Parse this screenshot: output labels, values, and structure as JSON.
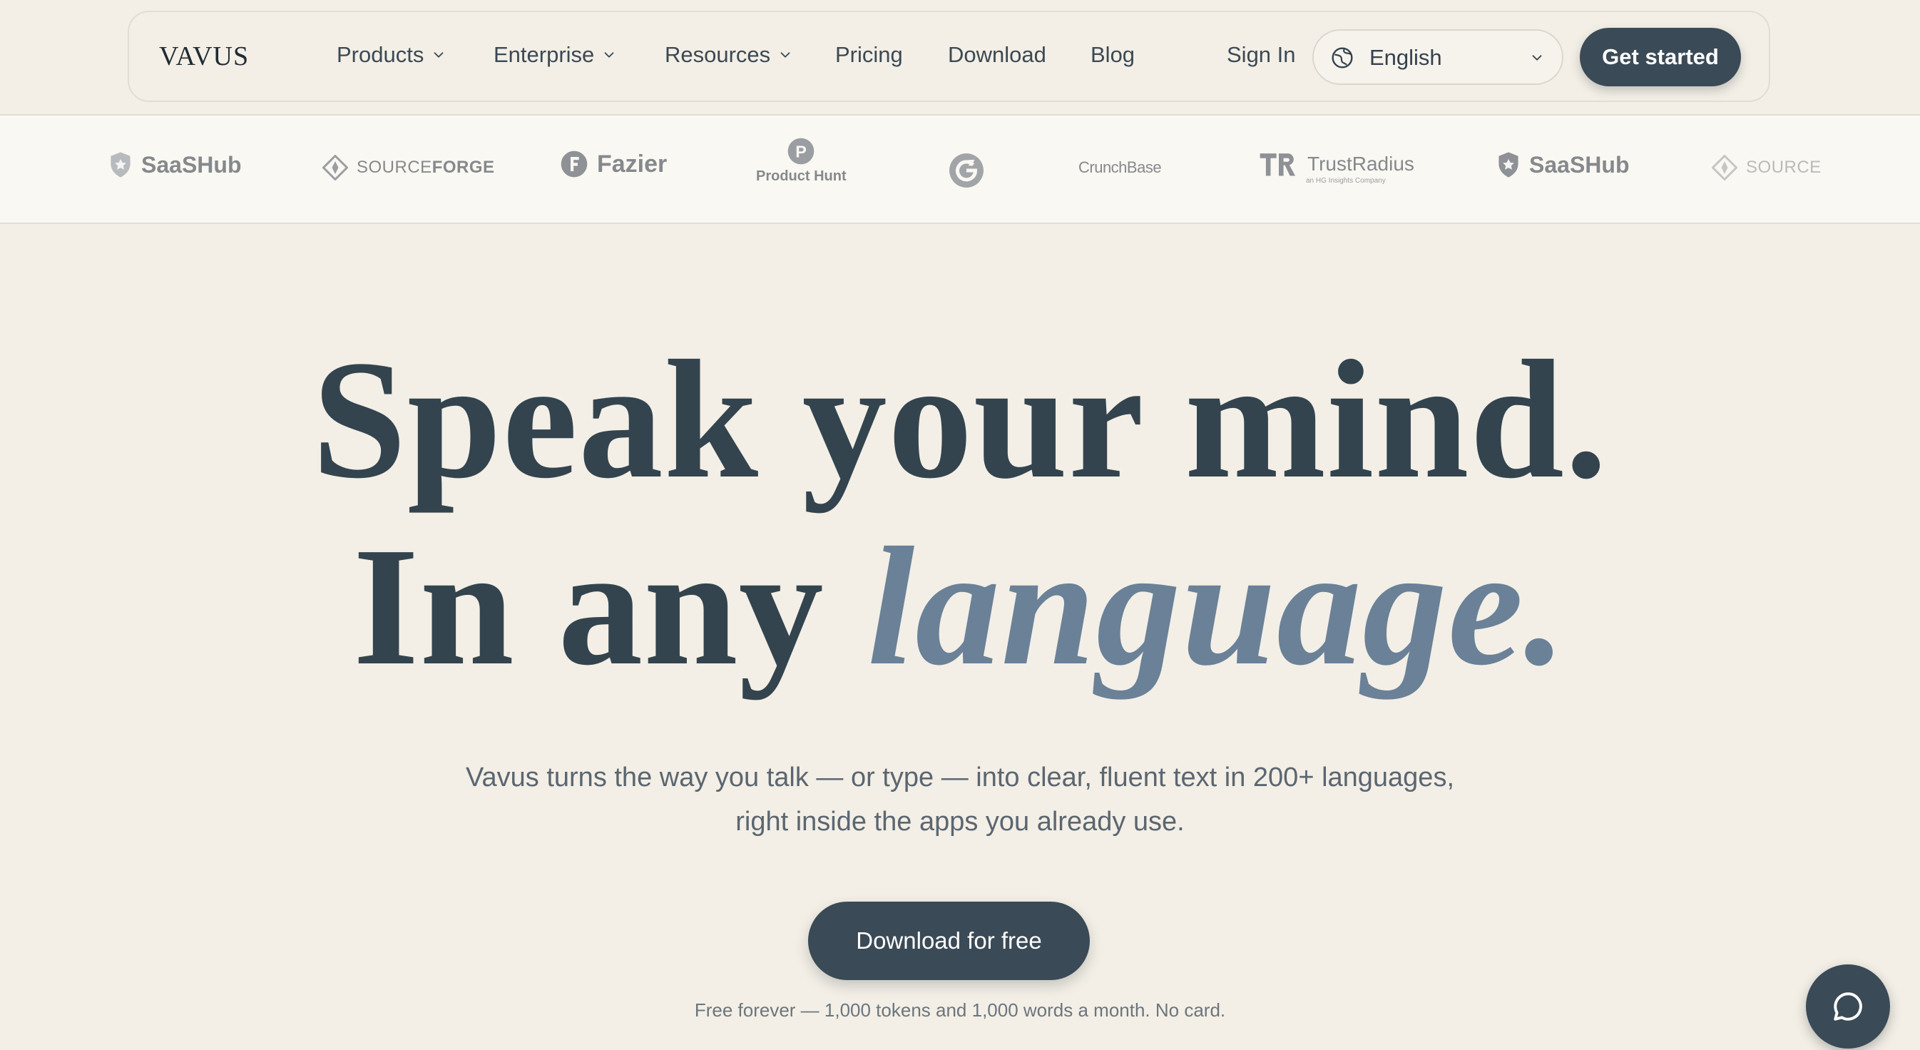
{
  "nav": {
    "logo": "VAVUS",
    "links": {
      "products": "Products",
      "enterprise": "Enterprise",
      "resources": "Resources",
      "pricing": "Pricing",
      "download": "Download",
      "blog": "Blog"
    },
    "sign_in": "Sign In",
    "language": "English",
    "get_started": "Get started"
  },
  "logo_strip": {
    "saashub": "SaaSHub",
    "sourceforge_light": "SOURCE",
    "sourceforge_bold": "FORGE",
    "fazier": "Fazier",
    "product_hunt": "Product Hunt",
    "product_hunt_mark": "P",
    "crunchbase": "CrunchBase",
    "trustradius": "TrustRadius",
    "trustradius_sub": "an HG Insights Company",
    "saashub_2": "SaaSHub",
    "sourceforge_2": "SOURCE"
  },
  "hero": {
    "line1": "Speak your mind.",
    "line2_plain": "In any ",
    "line2_accent": "language.",
    "sub_line1": "Vavus turns the way you talk — or type — into clear, fluent text in 200+ languages,",
    "sub_line2": "right inside the apps you already use.",
    "cta": "Download for free",
    "fine_print": "Free forever — 1,000 tokens and 1,000 words a month. No card."
  },
  "colors": {
    "background": "#f3efe6",
    "strip_background": "#faf8f2",
    "primary_button": "#3a4a56",
    "heading": "#33444f",
    "accent": "#6a8198"
  },
  "icons": {
    "nav_dropdown": "chevron-down-icon",
    "language": "globe-icon",
    "chat": "chat-bubble-icon"
  }
}
